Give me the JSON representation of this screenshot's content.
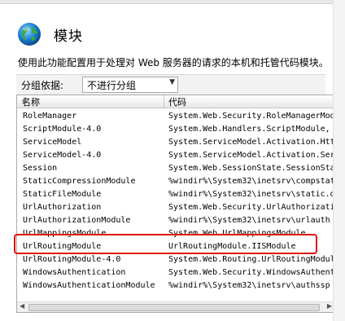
{
  "page": {
    "title": "模块",
    "description": "使用此功能配置用于处理对 Web 服务器的请求的本机和托管代码模块。"
  },
  "group": {
    "label": "分组依据:",
    "value": "不进行分组"
  },
  "columns": {
    "name": "名称",
    "code": "代码"
  },
  "rows": [
    {
      "name": "RoleManager",
      "code": "System.Web.Security.RoleManagerModu"
    },
    {
      "name": "ScriptModule-4.0",
      "code": "System.Web.Handlers.ScriptModule,"
    },
    {
      "name": "ServiceModel",
      "code": "System.ServiceModel.Activation.Http"
    },
    {
      "name": "ServiceModel-4.0",
      "code": "System.ServiceModel.Activation.Ser"
    },
    {
      "name": "Session",
      "code": "System.Web.SessionState.SessionStat"
    },
    {
      "name": "StaticCompressionModule",
      "code": "%windir%\\System32\\inetsrv\\compstat"
    },
    {
      "name": "StaticFileModule",
      "code": "%windir%\\System32\\inetsrv\\static.d"
    },
    {
      "name": "UrlAuthorization",
      "code": "System.Web.Security.UrlAuthorizatio"
    },
    {
      "name": "UrlAuthorizationModule",
      "code": "%windir%\\System32\\inetsrv\\urlauth"
    },
    {
      "name": "UrlMappingsModule",
      "code": "System.Web.UrlMappingsModule"
    },
    {
      "name": "UrlRoutingModule",
      "code": "UrlRoutingModule.IISModule"
    },
    {
      "name": "UrlRoutingModule-4.0",
      "code": "System.Web.Routing.UrlRoutingModule"
    },
    {
      "name": "WindowsAuthentication",
      "code": "System.Web.Security.WindowsAuthentic"
    },
    {
      "name": "WindowsAuthenticationModule",
      "code": "%windir%\\System32\\inetsrv\\authssp"
    }
  ],
  "highlighted_row": "UrlRoutingModule",
  "colors": {
    "highlight": "#e01010",
    "header_bg": "#e8e8e8"
  },
  "icons": {
    "page": "globe-icon",
    "dropdown": "chevron-down-icon",
    "sort": "sort-asc-icon"
  }
}
